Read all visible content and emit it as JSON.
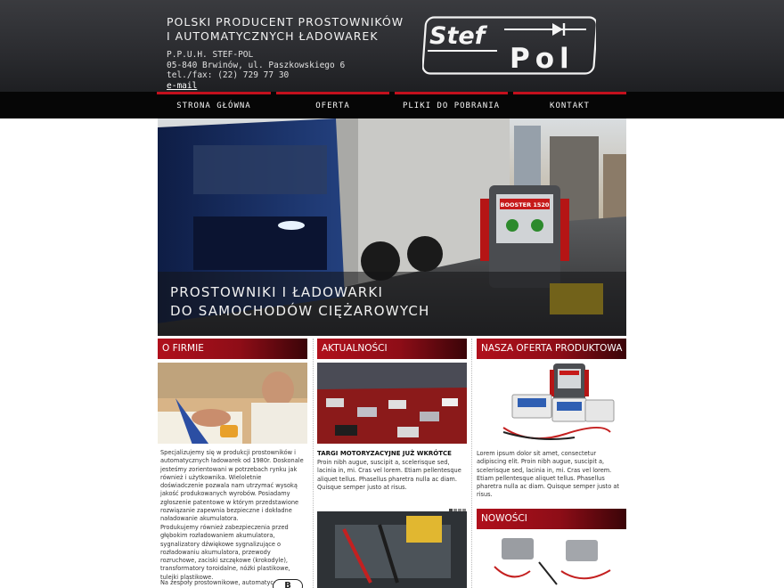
{
  "header": {
    "tagline_line1": "POLSKI PRODUCENT PROSTOWNIKÓW",
    "tagline_line2": "I AUTOMATYCZNYCH ŁADOWAREK",
    "company": "P.P.U.H. STEF-POL",
    "address": "05-840 Brwinów, ul. Paszkowskiego 6",
    "phone": "tel./fax: (22) 729 77 30",
    "email_link": "e-mail",
    "logo_text_top": "Stef",
    "logo_text_bottom": "Pol"
  },
  "nav": {
    "items": [
      {
        "label": "STRONA GŁÓWNA"
      },
      {
        "label": "OFERTA"
      },
      {
        "label": "PLIKI DO POBRANIA"
      },
      {
        "label": "KONTAKT"
      }
    ]
  },
  "hero": {
    "line1": "PROSTOWNIKI I ŁADOWARKI",
    "line2": "DO SAMOCHODÓW CIĘŻAROWYCH",
    "device_label": "BOOSTER 1520"
  },
  "about": {
    "heading": "O FIRMIE",
    "text1": "Specjalizujemy się w produkcji prostowników i automatycznych ładowarek od 1980r. Doskonale jesteśmy zorientowani w potrzebach rynku jak również i użytkownika. Wieloletnie doświadczenie pozwala nam utrzymać wysoką jakość produkowanych wyrobów. Posiadamy zgłoszenie patentowe w którym przedstawione rozwiązanie zapewnia bezpieczne i dokładne naładowanie akumulatora.",
    "text2": "Produkujemy również zabezpieczenia przed głębokim rozładowaniem akumulatora, sygnalizatory dźwiękowe sygnalizujące o rozładowaniu akumulatora, przewody rozruchowe, zaciski szczękowe (krokodyle), transformatory toroidalne, nóżki plastikowe, tulejki plastikowe.",
    "text3": "Na zespoły prostownikowe, automatyc-",
    "badge": "B"
  },
  "news": {
    "heading": "AKTUALNOŚCI",
    "item_title": "TARGI MOTORYZACYJNE JUŻ WKRÓTCE",
    "item_text": "Proin nibh augue, suscipit a, scelerisque sed, lacinia in, mi. Cras vel lorem. Etiam pellentesque aliquet tellus. Phasellus pharetra nulla ac diam. Quisque semper justo at risus."
  },
  "offer": {
    "heading": "NASZA OFERTA PRODUKTOWA",
    "text": "Lorem ipsum dolor sit amet, consectetur adipiscing elit. Proin nibh augue, suscipit a, scelerisque sed, lacinia in, mi. Cras vel lorem. Etiam pellentesque aliquet tellus. Phasellus pharetra nulla ac diam. Quisque semper justo at risus."
  },
  "new": {
    "heading": "NOWOŚCI"
  },
  "colors": {
    "accent_red": "#c4101d",
    "header_bg": "#2c2d31",
    "nav_bg": "#060606"
  }
}
